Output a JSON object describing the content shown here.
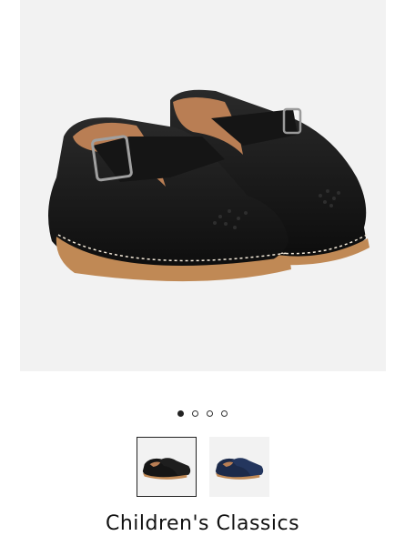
{
  "product": {
    "brand": "Children's Classics",
    "image_alt": "Black leather T-bar shoes",
    "gallery": {
      "total_images": 4,
      "active_index": 0
    },
    "thumbnails": [
      {
        "color_name": "black",
        "hex": "#151515"
      },
      {
        "color_name": "navy",
        "hex": "#1c2a4a"
      }
    ],
    "colors": {
      "leather_black": "#151515",
      "sole_tan": "#c08955",
      "lining_tan": "#b97e54",
      "background": "#f2f2f2"
    }
  }
}
